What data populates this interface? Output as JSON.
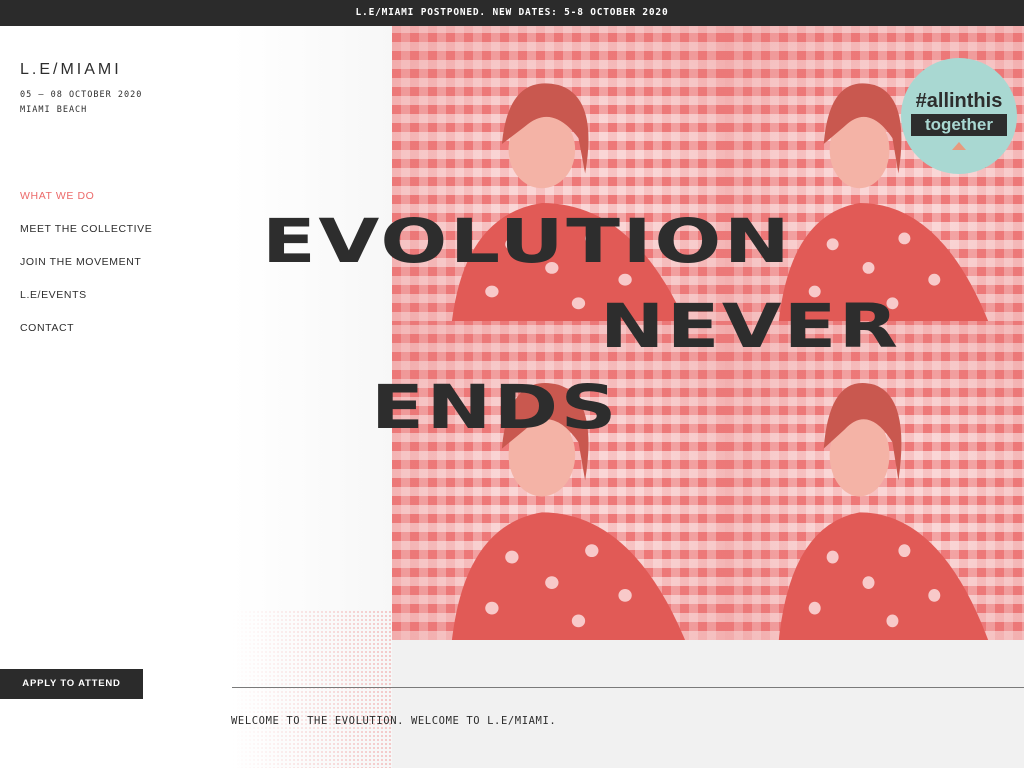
{
  "announcement": {
    "text": "L.E/MIAMI POSTPONED. NEW DATES: 5-8 OCTOBER 2020"
  },
  "brand": {
    "logo": "L.E/MIAMI",
    "dates": "05 – 08 OCTOBER 2020",
    "location": "MIAMI BEACH"
  },
  "nav": {
    "items": [
      {
        "label": "WHAT WE DO",
        "active": true
      },
      {
        "label": "MEET THE COLLECTIVE",
        "active": false
      },
      {
        "label": "JOIN THE MOVEMENT",
        "active": false
      },
      {
        "label": "L.E/EVENTS",
        "active": false
      },
      {
        "label": "CONTACT",
        "active": false
      }
    ]
  },
  "cta": {
    "apply_label": "APPLY TO ATTEND"
  },
  "hero": {
    "headline": [
      "EVOLUTION",
      "NEVER",
      "ENDS"
    ],
    "badge": {
      "line1": "#allinthis",
      "line2": "together"
    }
  },
  "welcome": {
    "text": "WELCOME TO THE EVOLUTION. WELCOME TO L.E/MIAMI."
  },
  "colors": {
    "accent": "#ec6a6a",
    "dark": "#2b2b2b",
    "badge": "#a9d8d2",
    "hero_pink": "#f3a4a4"
  }
}
